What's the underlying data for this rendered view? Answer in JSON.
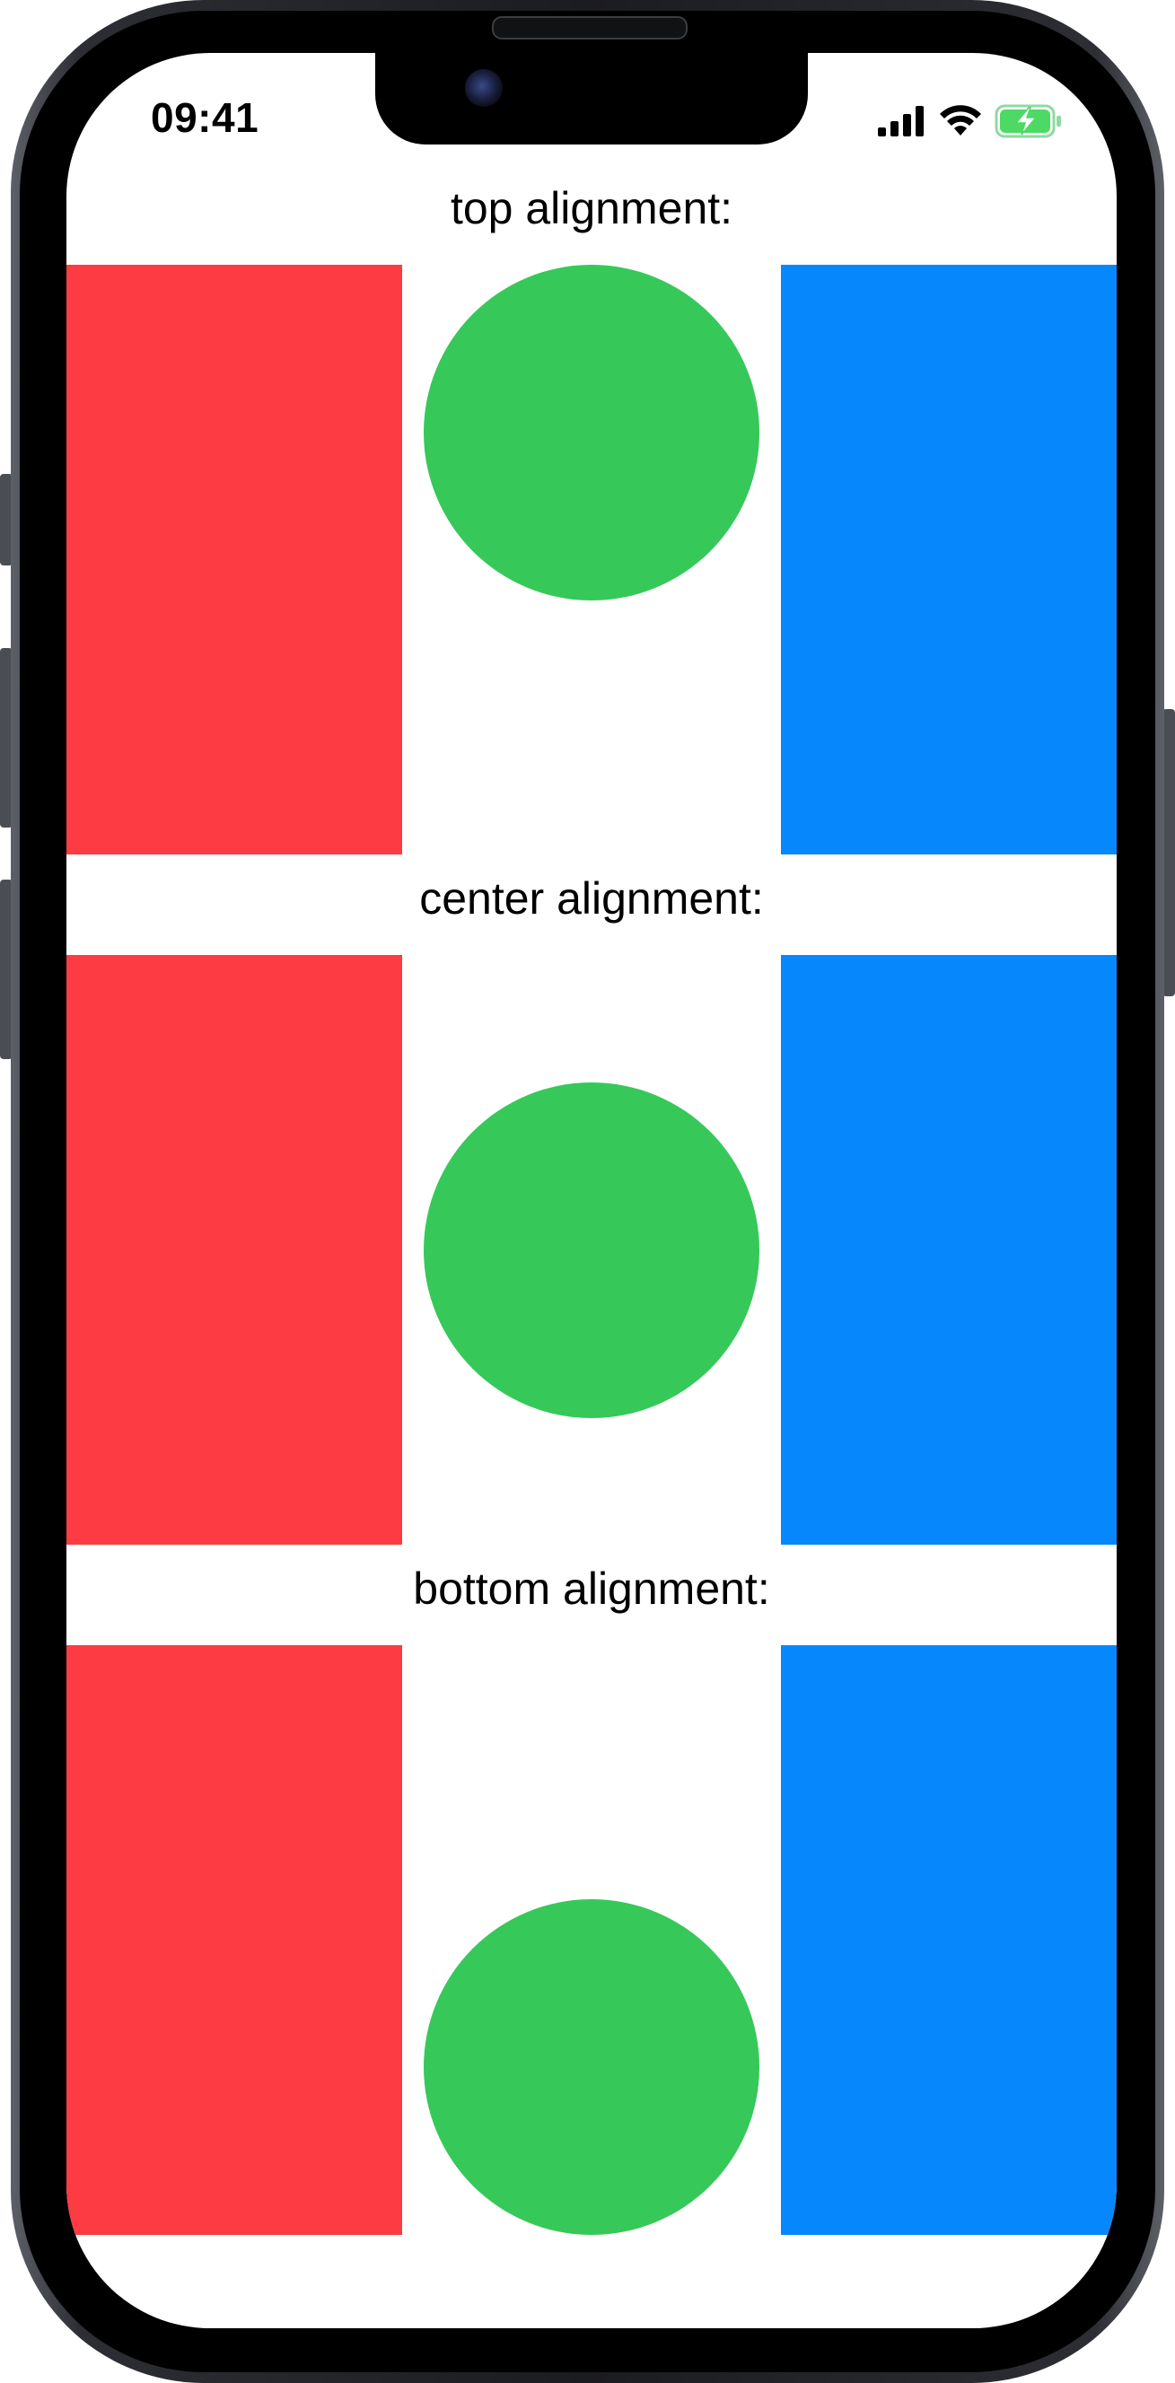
{
  "status_bar": {
    "time": "09:41",
    "icons": [
      "cellular-signal-icon",
      "wifi-icon",
      "battery-charging-icon"
    ]
  },
  "sections": [
    {
      "label": "top alignment:",
      "alignment": "top"
    },
    {
      "label": "center alignment:",
      "alignment": "center"
    },
    {
      "label": "bottom alignment:",
      "alignment": "bottom"
    }
  ],
  "colors": {
    "red": "#fc3b42",
    "green": "#37c85a",
    "blue": "#0688fc",
    "battery": "#4cd964"
  }
}
